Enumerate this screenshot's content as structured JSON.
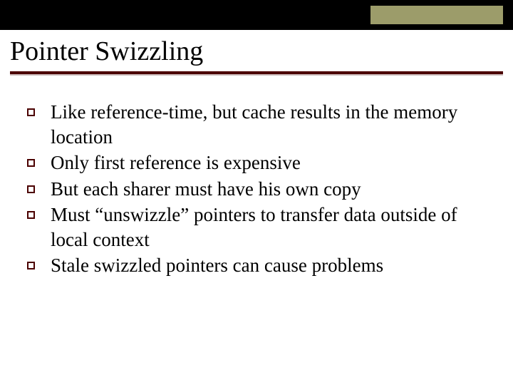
{
  "title": "Pointer Swizzling",
  "bullets": [
    "Like reference-time, but cache results in the memory location",
    "Only first reference is expensive",
    "But each sharer must have his own copy",
    "Must “unswizzle” pointers to transfer data outside of local context",
    "Stale swizzled pointers can cause problems"
  ],
  "colors": {
    "banner": "#000000",
    "olive": "#9c9c6a",
    "rule": "#4b0000"
  }
}
